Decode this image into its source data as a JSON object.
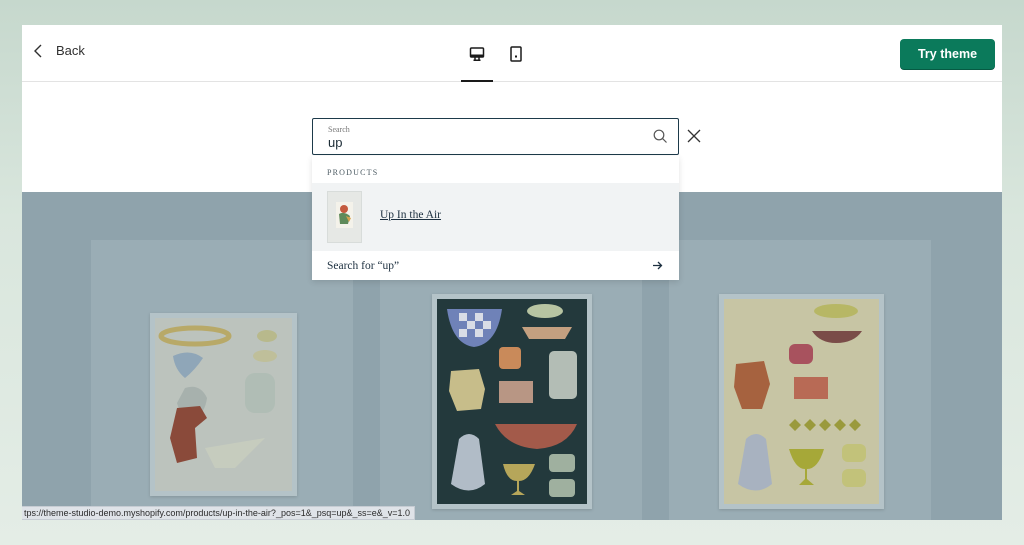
{
  "topbar": {
    "back_label": "Back",
    "devices": [
      {
        "name": "desktop",
        "icon": "desktop-icon",
        "active": true
      },
      {
        "name": "mobile",
        "icon": "mobile-icon",
        "active": false
      }
    ],
    "try_theme_label": "Try theme"
  },
  "search": {
    "label": "Search",
    "value": "up",
    "search_icon": "search-icon",
    "close_icon": "close-icon"
  },
  "dropdown": {
    "heading": "PRODUCTS",
    "results": [
      {
        "title": "Up In the Air",
        "thumb": "product-thumbnail"
      }
    ],
    "search_for_label": "Search for “up”",
    "arrow_icon": "arrow-right-icon"
  },
  "statusbar": {
    "url": "tps://theme-studio-demo.myshopify.com/products/up-in-the-air?_pos=1&_psq=up&_ss=e&_v=1.0"
  },
  "colors": {
    "accent": "#0b7a5b",
    "overlay": "#8fa3ac",
    "search_border": "#1d3a4a"
  }
}
